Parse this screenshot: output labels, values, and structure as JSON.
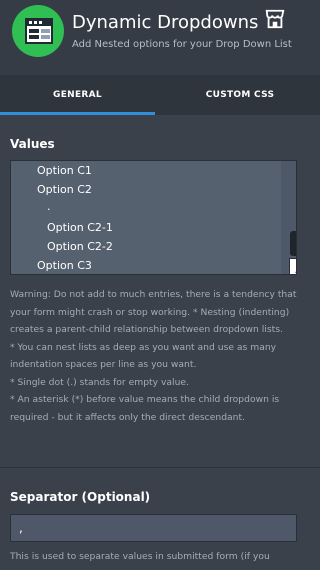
{
  "header": {
    "title": "Dynamic Dropdowns",
    "subtitle": "Add Nested options for your Drop Down List",
    "app_icon": "dynamic-dropdowns-app-icon",
    "store_icon": "store-icon"
  },
  "tabs": [
    {
      "label": "GENERAL",
      "active": true
    },
    {
      "label": "CUSTOM CSS",
      "active": false
    }
  ],
  "values": {
    "label": "Values",
    "lines": [
      "Option C1",
      "Option C2",
      ".",
      "Option C2-1",
      "Option C2-2",
      "Option C3"
    ]
  },
  "values_help": {
    "p1": "Warning: Do not add to much entries, there is a tendency that your form might crash or stop working. * Nesting (indenting) creates a parent-child relationship between dropdown lists.",
    "p2": "* You can nest lists as deep as you want and use as many indentation spaces per line as you want.",
    "p3": "* Single dot (.) stands for empty value.",
    "p4": "* An asterisk (*) before value means the child dropdown is required - but it affects only the direct descendant."
  },
  "separator": {
    "label": "Separator (Optional)",
    "value": ",",
    "help": "This is used to separate values in submitted form (if you"
  },
  "colors": {
    "accent": "#2f8fdb",
    "icon_green": "#2fbf52",
    "background": "#3a414b"
  }
}
